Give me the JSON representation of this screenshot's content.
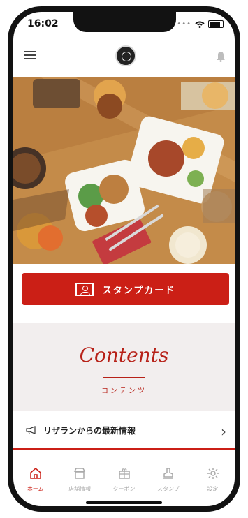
{
  "status": {
    "time": "16:02"
  },
  "header": {
    "logo_name": "logo",
    "menu_icon": "hamburger-icon",
    "bell_icon": "bell-icon"
  },
  "hero": {
    "description": ""
  },
  "stamp_card": {
    "label": "スタンプカード",
    "icon": "stamp-card-icon",
    "bg_color": "#cb1f16"
  },
  "contents": {
    "title": "Contents",
    "subtitle": "コンテンツ"
  },
  "news": {
    "label": "リザランからの最新情報",
    "icon": "megaphone-icon"
  },
  "tabs": [
    {
      "label": "ホーム",
      "icon": "home-icon",
      "active": true
    },
    {
      "label": "店舗情報",
      "icon": "store-icon",
      "active": false
    },
    {
      "label": "クーポン",
      "icon": "gift-icon",
      "active": false
    },
    {
      "label": "スタンプ",
      "icon": "stamp-icon",
      "active": false
    },
    {
      "label": "設定",
      "icon": "gear-icon",
      "active": false
    }
  ],
  "colors": {
    "accent": "#cb1f16",
    "contents_bg": "#f2eeee"
  }
}
